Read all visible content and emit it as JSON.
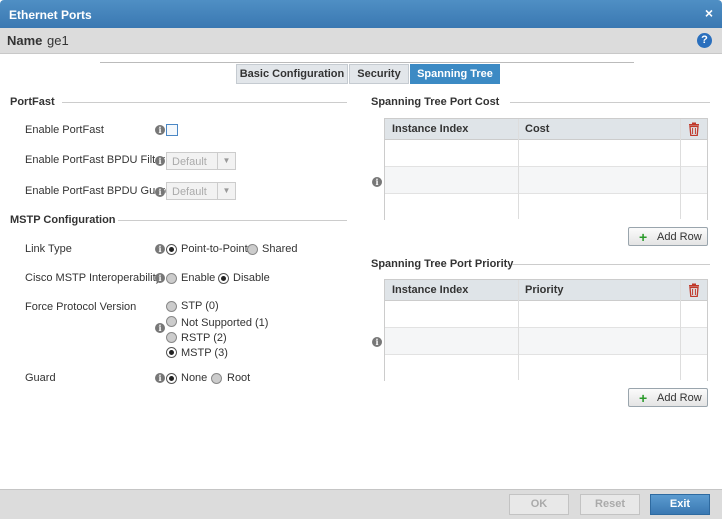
{
  "window": {
    "title": "Ethernet Ports",
    "close": "×"
  },
  "name": {
    "label": "Name",
    "value": "ge1"
  },
  "tabs": [
    {
      "label": "Basic Configuration",
      "active": false
    },
    {
      "label": "Security",
      "active": false
    },
    {
      "label": "Spanning Tree",
      "active": true
    }
  ],
  "portfast": {
    "title": "PortFast",
    "enable_label": "Enable PortFast",
    "enable_checked": false,
    "bpdu_filter_label": "Enable PortFast BPDU Filter",
    "bpdu_filter_value": "Default",
    "bpdu_guard_label": "Enable PortFast BPDU Guard",
    "bpdu_guard_value": "Default"
  },
  "mstp": {
    "title": "MSTP Configuration",
    "link_type_label": "Link Type",
    "link_type_options": [
      "Point-to-Point",
      "Shared"
    ],
    "link_type_selected": "Point-to-Point",
    "cisco_label": "Cisco MSTP Interoperability",
    "cisco_options": [
      "Enable",
      "Disable"
    ],
    "cisco_selected": "Disable",
    "force_label": "Force Protocol Version",
    "force_options": [
      "STP (0)",
      "Not Supported (1)",
      "RSTP (2)",
      "MSTP (3)"
    ],
    "force_selected": "MSTP (3)",
    "guard_label": "Guard",
    "guard_options": [
      "None",
      "Root"
    ],
    "guard_selected": "None"
  },
  "port_cost": {
    "title": "Spanning Tree Port Cost",
    "col1": "Instance Index",
    "col2": "Cost",
    "add_label": "Add Row"
  },
  "port_priority": {
    "title": "Spanning Tree Port Priority",
    "col1": "Instance Index",
    "col2": "Priority",
    "add_label": "Add Row"
  },
  "footer": {
    "ok": "OK",
    "reset": "Reset",
    "exit": "Exit"
  },
  "icons": {
    "info": "info-icon",
    "help": "help-icon",
    "trash": "trash-icon",
    "add": "plus-icon"
  },
  "colors": {
    "accent": "#3c8ac4",
    "trash": "#c0392b",
    "add": "#2a9a2a"
  }
}
